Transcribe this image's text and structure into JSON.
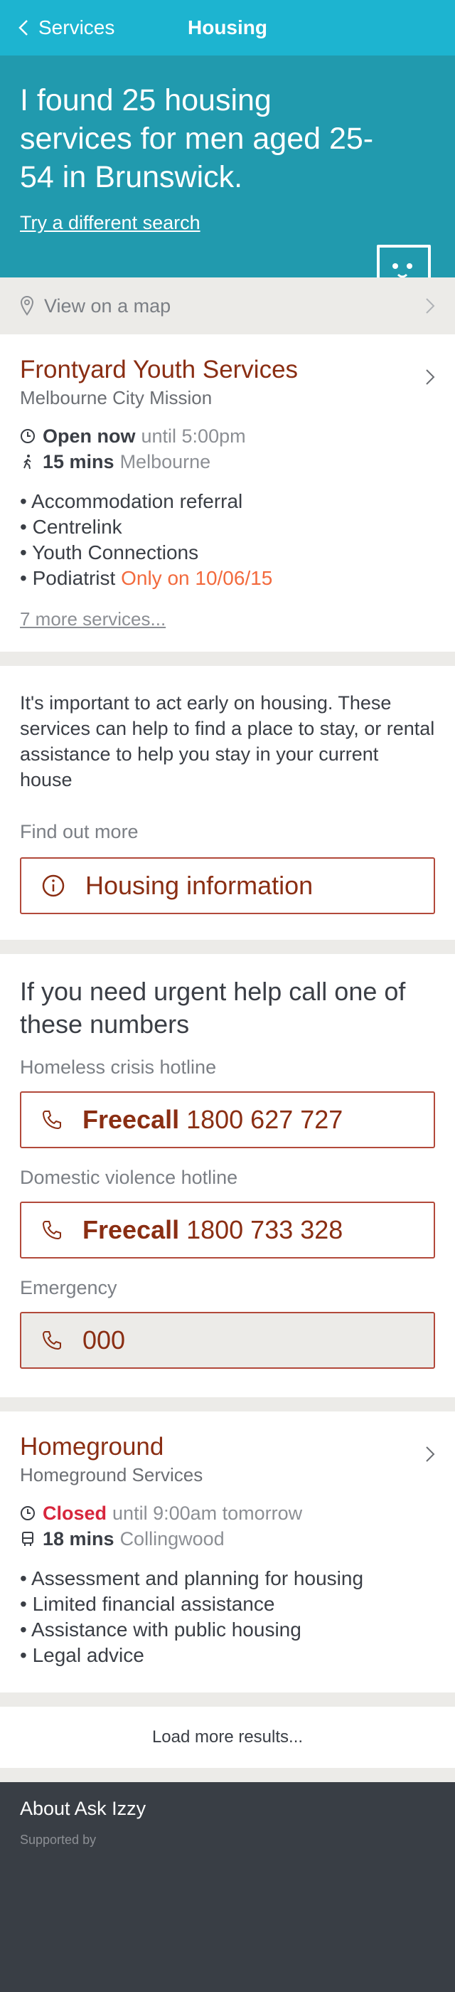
{
  "header": {
    "back_label": "Services",
    "title": "Housing"
  },
  "hero": {
    "heading": "I found 25 housing services for men aged 25-54 in Brunswick.",
    "link": "Try a different search"
  },
  "map_row": {
    "label": "View on a map"
  },
  "results": [
    {
      "title": "Frontyard Youth Services",
      "org": "Melbourne City Mission",
      "status_strong": "Open now",
      "status_rest": "until 5:00pm",
      "travel_time": "15 mins",
      "travel_place": "Melbourne",
      "travel_mode": "walk",
      "services": [
        {
          "name": "Accommodation referral",
          "note": ""
        },
        {
          "name": "Centrelink",
          "note": ""
        },
        {
          "name": "Youth Connections",
          "note": ""
        },
        {
          "name": "Podiatrist",
          "note": "Only on 10/06/15"
        }
      ],
      "more_link": "7 more services..."
    },
    {
      "title": "Homeground",
      "org": "Homeground Services",
      "status_strong": "Closed",
      "status_rest": "until 9:00am tomorrow",
      "travel_time": "18 mins",
      "travel_place": "Collingwood",
      "travel_mode": "bus",
      "services": [
        {
          "name": "Assessment and planning for housing",
          "note": ""
        },
        {
          "name": "Limited financial assistance",
          "note": ""
        },
        {
          "name": "Assistance with public housing",
          "note": ""
        },
        {
          "name": "Legal advice",
          "note": ""
        }
      ]
    }
  ],
  "info_card": {
    "text": "It's important to act early on housing. These services can help to find a place to stay, or rental assistance to help you stay in your current house",
    "find_out_label": "Find out more",
    "button_label": "Housing information"
  },
  "urgent": {
    "heading": "If you need urgent help call one of these numbers",
    "hotlines": [
      {
        "label": "Homeless crisis hotline",
        "prefix": "Freecall",
        "number": "1800 627 727"
      },
      {
        "label": "Domestic violence hotline",
        "prefix": "Freecall",
        "number": "1800 733 328"
      },
      {
        "label": "Emergency",
        "prefix": "",
        "number": "000"
      }
    ]
  },
  "load_more": "Load more results...",
  "footer": {
    "title": "About Ask Izzy",
    "supported_by": "Supported by"
  },
  "colors": {
    "appbar": "#1db4d0",
    "hero": "#219aae",
    "accent": "#8a2e13",
    "closed": "#d7263d",
    "note": "#f26a3d",
    "footer": "#393e45"
  }
}
